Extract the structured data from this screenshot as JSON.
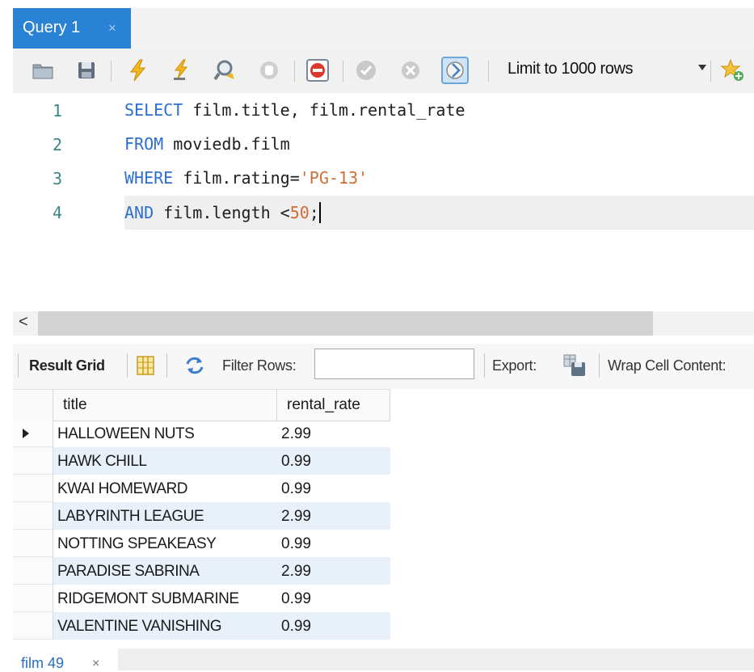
{
  "query_tab": {
    "label": "Query 1",
    "close": "×"
  },
  "toolbar": {
    "limit_label": "Limit to 1000 rows",
    "icons": [
      "open-folder-icon",
      "save-icon",
      "execute-lightning-icon",
      "execute-current-icon",
      "explain-magnifier-icon",
      "stop-icon",
      "stop-on-error-icon",
      "commit-icon",
      "rollback-icon",
      "autocommit-toggle-icon",
      "favorites-star-icon"
    ]
  },
  "editor": {
    "lines": [
      {
        "num": "1",
        "parts": [
          {
            "t": "kw",
            "v": "SELECT"
          },
          {
            "t": "plain",
            "v": " film.title, film.rental_rate"
          }
        ]
      },
      {
        "num": "2",
        "parts": [
          {
            "t": "kw",
            "v": "FROM"
          },
          {
            "t": "plain",
            "v": " moviedb.film"
          }
        ]
      },
      {
        "num": "3",
        "parts": [
          {
            "t": "kw",
            "v": "WHERE"
          },
          {
            "t": "plain",
            "v": " film.rating="
          },
          {
            "t": "str",
            "v": "'PG-13'"
          }
        ]
      },
      {
        "num": "4",
        "parts": [
          {
            "t": "kw",
            "v": "AND"
          },
          {
            "t": "plain",
            "v": " film.length <"
          },
          {
            "t": "str",
            "v": "50"
          },
          {
            "t": "plain",
            "v": ";"
          }
        ]
      }
    ]
  },
  "scrollbar": {
    "left_arrow": "<"
  },
  "result_toolbar": {
    "result_grid": "Result Grid",
    "filter_rows": "Filter Rows:",
    "filter_value": "",
    "export": "Export:",
    "wrap": "Wrap Cell Content:"
  },
  "grid": {
    "columns": [
      "title",
      "rental_rate"
    ],
    "rows": [
      {
        "title": "HALLOWEEN NUTS",
        "rental_rate": "2.99"
      },
      {
        "title": "HAWK CHILL",
        "rental_rate": "0.99"
      },
      {
        "title": "KWAI HOMEWARD",
        "rental_rate": "0.99"
      },
      {
        "title": "LABYRINTH LEAGUE",
        "rental_rate": "2.99"
      },
      {
        "title": "NOTTING SPEAKEASY",
        "rental_rate": "0.99"
      },
      {
        "title": "PARADISE SABRINA",
        "rental_rate": "2.99"
      },
      {
        "title": "RIDGEMONT SUBMARINE",
        "rental_rate": "0.99"
      },
      {
        "title": "VALENTINE VANISHING",
        "rental_rate": "0.99"
      }
    ]
  },
  "result_tab": {
    "label": "film 49",
    "close": "×"
  }
}
